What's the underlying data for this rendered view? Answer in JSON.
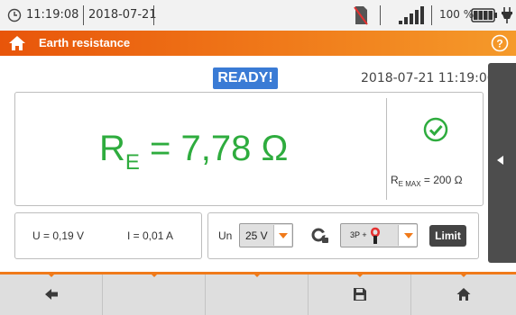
{
  "status_bar": {
    "time": "11:19:08",
    "date": "2018-07-21",
    "battery_percent": "100 %",
    "icons": [
      "clock-icon",
      "no-memory-card-icon",
      "signal-icon",
      "battery-icon",
      "plug-icon"
    ]
  },
  "title_bar": {
    "title": "Earth resistance",
    "icons": [
      "home-icon",
      "help-icon"
    ]
  },
  "status": {
    "ready_label": "READY!",
    "datetime": "2018-07-21 11:19:06"
  },
  "result": {
    "symbol": "R",
    "subscript": "E",
    "value_text": " = 7,78 Ω",
    "color": "#2eac3e",
    "re_max_symbol": "R",
    "re_max_subscript": "E MAX",
    "re_max_value_text": " = 200 Ω"
  },
  "measurements": {
    "voltage": "U = 0,19 V",
    "current": "I = 0,01 A"
  },
  "settings": {
    "un_label": "Un",
    "un_value": "25 V",
    "mode_value": "3P +",
    "limit_label": "Limit"
  },
  "toolbar": {
    "buttons": [
      "back-icon",
      "blank",
      "blank",
      "save-icon",
      "home-icon"
    ]
  },
  "colors": {
    "accent": "#f07a1a",
    "ready_badge": "#3a7bd5",
    "result_green": "#2eac3e",
    "dark_button": "#444444"
  }
}
